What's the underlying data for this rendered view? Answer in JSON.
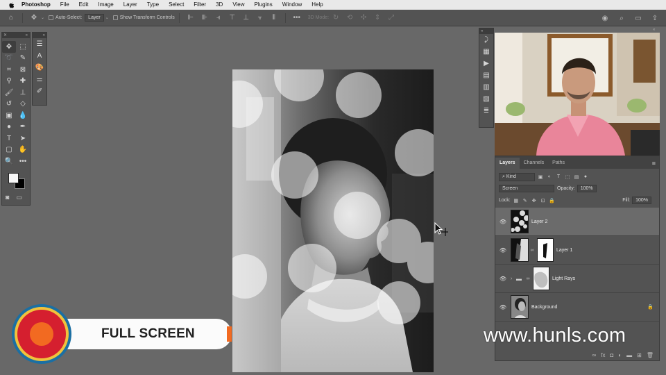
{
  "menubar": {
    "apple": "",
    "items": [
      "Photoshop",
      "File",
      "Edit",
      "Image",
      "Layer",
      "Type",
      "Select",
      "Filter",
      "3D",
      "View",
      "Plugins",
      "Window",
      "Help"
    ]
  },
  "options": {
    "auto_select_label": "Auto-Select:",
    "auto_select_value": "Layer",
    "show_transform_label": "Show Transform Controls",
    "mode_3d_label": "3D Mode:"
  },
  "layers_panel": {
    "tabs": [
      "Layers",
      "Channels",
      "Paths"
    ],
    "filter_kind": "Kind",
    "blend_mode": "Screen",
    "opacity_label": "Opacity:",
    "opacity_value": "100%",
    "lock_label": "Lock:",
    "fill_label": "Fill:",
    "fill_value": "100%",
    "layers": [
      {
        "name": "Layer 2",
        "selected": true
      },
      {
        "name": "Layer 1",
        "selected": false
      },
      {
        "name": "Light Rays",
        "selected": false
      },
      {
        "name": "Background",
        "selected": false
      }
    ]
  },
  "lower_third": {
    "label": "FULL SCREEN",
    "colors": {
      "outer": "#1b6fa3",
      "ring": "#f0c23c",
      "inner": "#d51f2f",
      "core": "#f26a21"
    }
  },
  "watermark": "www.hunls.com",
  "icons": {
    "toolbar": [
      "move-icon",
      "marquee-icon",
      "lasso-icon",
      "quick-select-icon",
      "crop-icon",
      "frame-icon",
      "eyedropper-icon",
      "healing-icon",
      "brush-icon",
      "stamp-icon",
      "history-brush-icon",
      "eraser-icon",
      "gradient-icon",
      "blur-icon",
      "dodge-icon",
      "pen-icon",
      "type-icon",
      "path-select-icon",
      "rectangle-icon",
      "hand-icon",
      "zoom-icon",
      "more-icon"
    ]
  }
}
